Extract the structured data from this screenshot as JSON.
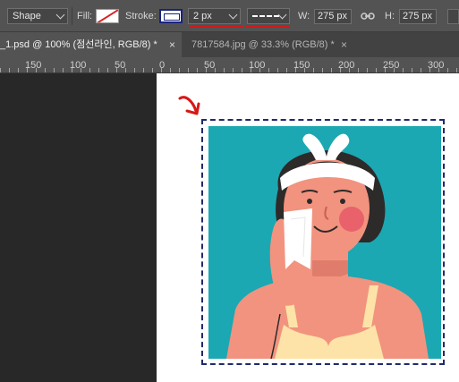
{
  "options": {
    "mode": "Shape",
    "fill_label": "Fill:",
    "stroke_label": "Stroke:",
    "stroke_width": "2 px",
    "w_label": "W:",
    "w_value": "275 px",
    "h_label": "H:",
    "h_value": "275 px"
  },
  "tabs": [
    {
      "label": "_1.psd @ 100% (점선라인, RGB/8) *",
      "close": "×"
    },
    {
      "label": "7817584.jpg @ 33.3% (RGB/8) *",
      "close": "×"
    }
  ],
  "ruler": {
    "labels": [
      "150",
      "100",
      "50",
      "0",
      "50",
      "100",
      "150",
      "200",
      "250",
      "300"
    ]
  },
  "colors": {
    "stroke": "#1f2a6b",
    "annotation": "#d61818",
    "photo_background": "#1ba8b2"
  }
}
